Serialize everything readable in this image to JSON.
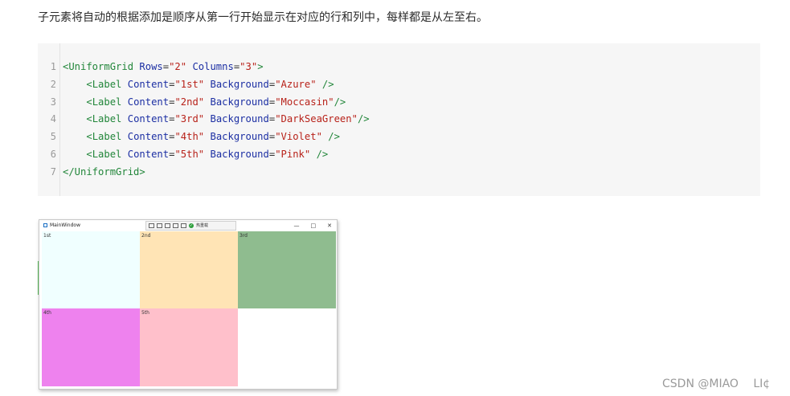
{
  "intro_text": "子元素将自动的根据添加是顺序从第一行开始显示在对应的行和列中，每样都是从左至右。",
  "code": {
    "line_numbers": [
      "1",
      "2",
      "3",
      "4",
      "5",
      "6",
      "7"
    ],
    "lines": [
      [
        {
          "t": "tag",
          "v": "<UniformGrid "
        },
        {
          "t": "attr",
          "v": "Rows"
        },
        {
          "t": "plain",
          "v": "="
        },
        {
          "t": "val",
          "v": "\"2\""
        },
        {
          "t": "plain",
          "v": " "
        },
        {
          "t": "attr",
          "v": "Columns"
        },
        {
          "t": "plain",
          "v": "="
        },
        {
          "t": "val",
          "v": "\"3\""
        },
        {
          "t": "tag",
          "v": ">"
        }
      ],
      [
        {
          "t": "plain",
          "v": "    "
        },
        {
          "t": "tag",
          "v": "<Label "
        },
        {
          "t": "attr",
          "v": "Content"
        },
        {
          "t": "plain",
          "v": "="
        },
        {
          "t": "val",
          "v": "\"1st\""
        },
        {
          "t": "plain",
          "v": " "
        },
        {
          "t": "attr",
          "v": "Background"
        },
        {
          "t": "plain",
          "v": "="
        },
        {
          "t": "val",
          "v": "\"Azure\""
        },
        {
          "t": "plain",
          "v": " "
        },
        {
          "t": "tag",
          "v": "/>"
        }
      ],
      [
        {
          "t": "plain",
          "v": "    "
        },
        {
          "t": "tag",
          "v": "<Label "
        },
        {
          "t": "attr",
          "v": "Content"
        },
        {
          "t": "plain",
          "v": "="
        },
        {
          "t": "val",
          "v": "\"2nd\""
        },
        {
          "t": "plain",
          "v": " "
        },
        {
          "t": "attr",
          "v": "Background"
        },
        {
          "t": "plain",
          "v": "="
        },
        {
          "t": "val",
          "v": "\"Moccasin\""
        },
        {
          "t": "tag",
          "v": "/>"
        }
      ],
      [
        {
          "t": "plain",
          "v": "    "
        },
        {
          "t": "tag",
          "v": "<Label "
        },
        {
          "t": "attr",
          "v": "Content"
        },
        {
          "t": "plain",
          "v": "="
        },
        {
          "t": "val",
          "v": "\"3rd\""
        },
        {
          "t": "plain",
          "v": " "
        },
        {
          "t": "attr",
          "v": "Background"
        },
        {
          "t": "plain",
          "v": "="
        },
        {
          "t": "val",
          "v": "\"DarkSeaGreen\""
        },
        {
          "t": "tag",
          "v": "/>"
        }
      ],
      [
        {
          "t": "plain",
          "v": "    "
        },
        {
          "t": "tag",
          "v": "<Label "
        },
        {
          "t": "attr",
          "v": "Content"
        },
        {
          "t": "plain",
          "v": "="
        },
        {
          "t": "val",
          "v": "\"4th\""
        },
        {
          "t": "plain",
          "v": " "
        },
        {
          "t": "attr",
          "v": "Background"
        },
        {
          "t": "plain",
          "v": "="
        },
        {
          "t": "val",
          "v": "\"Violet\""
        },
        {
          "t": "plain",
          "v": " "
        },
        {
          "t": "tag",
          "v": "/>"
        }
      ],
      [
        {
          "t": "plain",
          "v": "    "
        },
        {
          "t": "tag",
          "v": "<Label "
        },
        {
          "t": "attr",
          "v": "Content"
        },
        {
          "t": "plain",
          "v": "="
        },
        {
          "t": "val",
          "v": "\"5th\""
        },
        {
          "t": "plain",
          "v": " "
        },
        {
          "t": "attr",
          "v": "Background"
        },
        {
          "t": "plain",
          "v": "="
        },
        {
          "t": "val",
          "v": "\"Pink\""
        },
        {
          "t": "plain",
          "v": " "
        },
        {
          "t": "tag",
          "v": "/>"
        }
      ],
      [
        {
          "t": "tag",
          "v": "</UniformGrid>"
        }
      ]
    ]
  },
  "window": {
    "title": "MainWindow",
    "toolbar_label": "热重载",
    "controls": [
      "—",
      "□",
      "✕"
    ],
    "cells": [
      {
        "label": "1st",
        "color": "#f0ffff"
      },
      {
        "label": "2nd",
        "color": "#ffe4b5"
      },
      {
        "label": "3rd",
        "color": "#8fbc8f"
      },
      {
        "label": "4th",
        "color": "#ee82ee"
      },
      {
        "label": "5th",
        "color": "#ffc0cb"
      },
      {
        "label": "",
        "color": "#ffffff"
      }
    ]
  },
  "watermark": "CSDN @MIAO　 LI¢"
}
